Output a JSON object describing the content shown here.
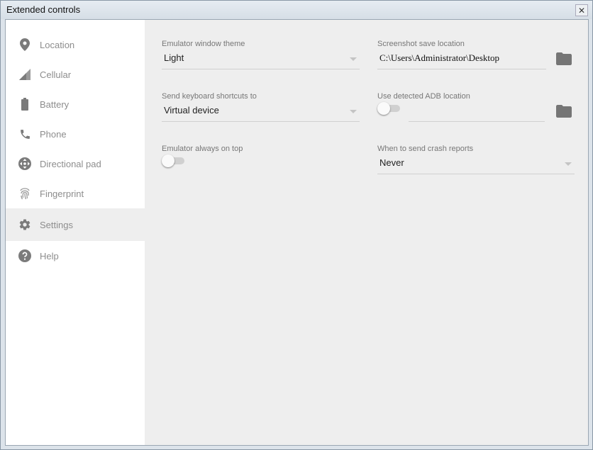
{
  "window": {
    "title": "Extended controls",
    "close_glyph": "✕"
  },
  "sidebar": {
    "items": [
      {
        "label": "Location",
        "icon": "location-pin-icon"
      },
      {
        "label": "Cellular",
        "icon": "cellular-signal-icon"
      },
      {
        "label": "Battery",
        "icon": "battery-icon"
      },
      {
        "label": "Phone",
        "icon": "phone-icon"
      },
      {
        "label": "Directional pad",
        "icon": "dpad-icon"
      },
      {
        "label": "Fingerprint",
        "icon": "fingerprint-icon"
      },
      {
        "label": "Settings",
        "icon": "gear-icon",
        "active": true
      },
      {
        "label": "Help",
        "icon": "help-icon"
      }
    ]
  },
  "settings": {
    "theme": {
      "label": "Emulator window theme",
      "value": "Light"
    },
    "screenshot": {
      "label": "Screenshot save location",
      "value": "C:\\Users\\Administrator\\Desktop"
    },
    "shortcuts": {
      "label": "Send keyboard shortcuts to",
      "value": "Virtual device"
    },
    "adb": {
      "label": "Use detected ADB location",
      "enabled": false,
      "value": ""
    },
    "on_top": {
      "label": "Emulator always on top",
      "enabled": false
    },
    "crash": {
      "label": "When to send crash reports",
      "value": "Never"
    }
  },
  "colors": {
    "icon": "#7b7b7b",
    "sidebar_bg": "#ffffff",
    "content_bg": "#eeeeee"
  }
}
